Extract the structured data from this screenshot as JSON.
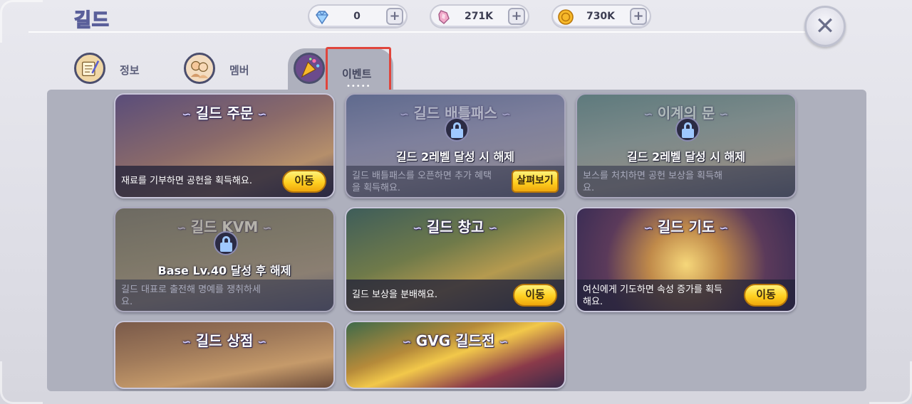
{
  "header": {
    "title": "길드",
    "currencies": [
      {
        "icon": "diamond-icon",
        "value": "0",
        "plus": "+"
      },
      {
        "icon": "crystal-icon",
        "value": "271K",
        "plus": "+"
      },
      {
        "icon": "gold-coin-icon",
        "value": "730K",
        "plus": "+"
      }
    ],
    "close": "✕"
  },
  "tabs": [
    {
      "label": "정보",
      "icon": "scroll-quill-icon"
    },
    {
      "label": "멤버",
      "icon": "members-icon"
    },
    {
      "label": "이벤트",
      "icon": "party-popper-icon",
      "dots": "•••••"
    }
  ],
  "cards": [
    {
      "title": "길드 주문",
      "desc": "재료를 기부하면 공헌을 획득해요.",
      "button": "이동",
      "locked": false
    },
    {
      "title": "길드 배틀패스",
      "lock_text": "길드 2레벨 달성 시 해제",
      "desc": "길드 배틀패스를 오픈하면 추가 혜택을 획득해요.",
      "button": "살펴보기",
      "locked": true
    },
    {
      "title": "이계의 문",
      "lock_text": "길드 2레벨 달성 시 해제",
      "desc": "보스를 처치하면 공헌 보상을 획득해요.",
      "locked": true
    },
    {
      "title": "길드 KVM",
      "lock_text": "Base Lv.40 달성 후 해제",
      "desc": "길드 대표로 출전해 명예를 쟁취하세요.",
      "locked": true
    },
    {
      "title": "길드 창고",
      "desc": "길드 보상을 분배해요.",
      "button": "이동",
      "locked": false
    },
    {
      "title": "길드 기도",
      "desc": "여신에게 기도하면 속성 증가를 획득해요.",
      "button": "이동",
      "locked": false
    },
    {
      "title": "길드 상점",
      "locked": false
    },
    {
      "title": "GVG 길드전",
      "locked": false
    }
  ],
  "colors": {
    "active_tab_highlight": "#e0453c",
    "go_button": "#ffd021",
    "panel": "#aeb0bd"
  }
}
